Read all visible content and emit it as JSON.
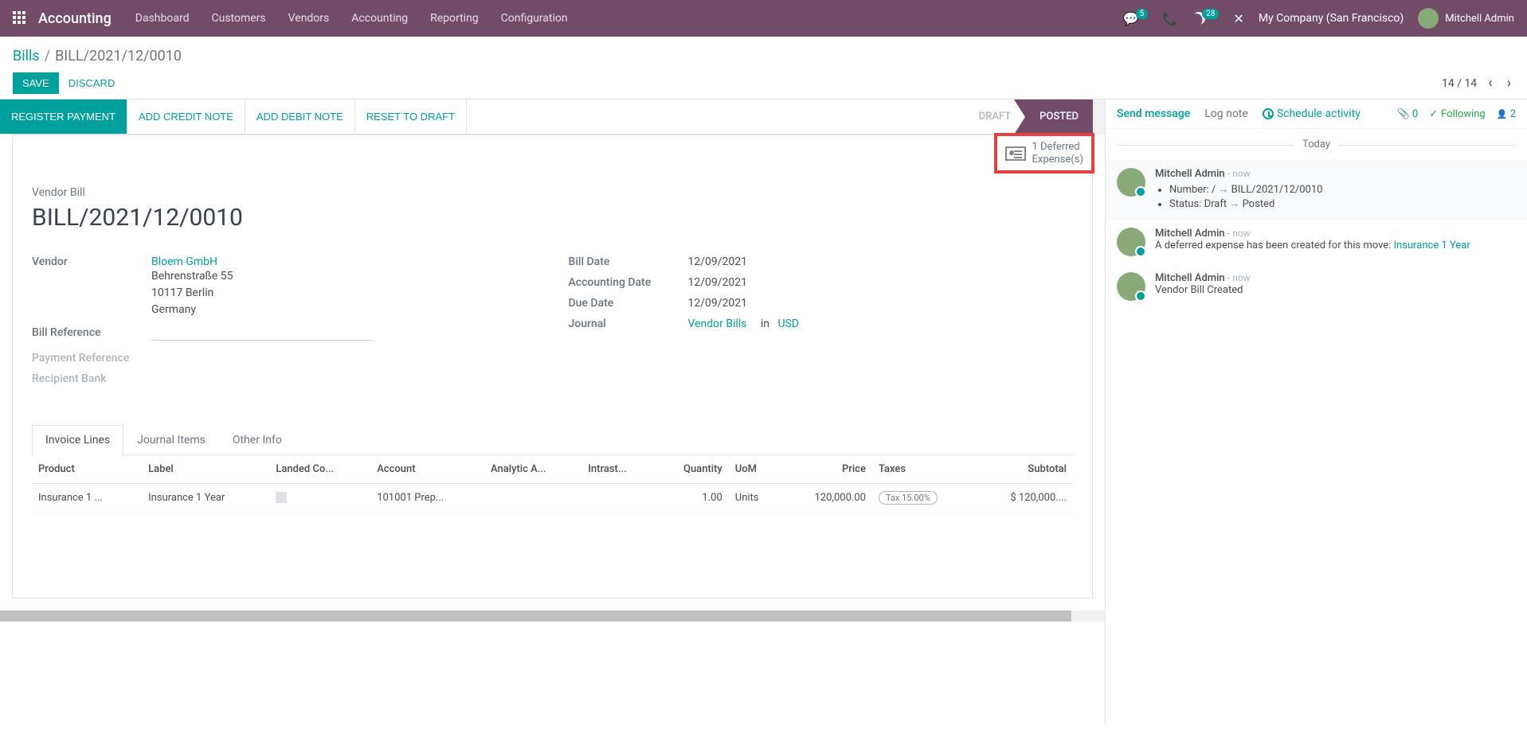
{
  "navbar": {
    "brand": "Accounting",
    "menu": [
      "Dashboard",
      "Customers",
      "Vendors",
      "Accounting",
      "Reporting",
      "Configuration"
    ],
    "messages_count": "5",
    "activities_count": "28",
    "company": "My Company (San Francisco)",
    "user": "Mitchell Admin"
  },
  "breadcrumb": {
    "root": "Bills",
    "current": "BILL/2021/12/0010"
  },
  "buttons": {
    "save": "SAVE",
    "discard": "DISCARD"
  },
  "pager": {
    "text": "14 / 14"
  },
  "statusbar": {
    "register_payment": "REGISTER PAYMENT",
    "add_credit": "ADD CREDIT NOTE",
    "add_debit": "ADD DEBIT NOTE",
    "reset": "RESET TO DRAFT",
    "draft": "DRAFT",
    "posted": "POSTED"
  },
  "stat_button": {
    "line1": "1 Deferred",
    "line2": "Expense(s)"
  },
  "sheet": {
    "label": "Vendor Bill",
    "title": "BILL/2021/12/0010",
    "left": {
      "vendor_label": "Vendor",
      "vendor_name": "Bloem GmbH",
      "addr1": "Behrenstraße 55",
      "addr2": "10117 Berlin",
      "addr3": "Germany",
      "bill_ref_label": "Bill Reference",
      "pay_ref_label": "Payment Reference",
      "bank_label": "Recipient Bank"
    },
    "right": {
      "bill_date_label": "Bill Date",
      "bill_date": "12/09/2021",
      "acct_date_label": "Accounting Date",
      "acct_date": "12/09/2021",
      "due_date_label": "Due Date",
      "due_date": "12/09/2021",
      "journal_label": "Journal",
      "journal": "Vendor Bills",
      "in": "in",
      "currency": "USD"
    }
  },
  "tabs": {
    "t1": "Invoice Lines",
    "t2": "Journal Items",
    "t3": "Other Info"
  },
  "table": {
    "headers": {
      "product": "Product",
      "label": "Label",
      "landed": "Landed Co...",
      "account": "Account",
      "analytic": "Analytic A...",
      "intrastat": "Intrast...",
      "qty": "Quantity",
      "uom": "UoM",
      "price": "Price",
      "taxes": "Taxes",
      "subtotal": "Subtotal"
    },
    "row": {
      "product": "Insurance 1 ...",
      "label": "Insurance 1 Year",
      "account": "101001 Prep...",
      "qty": "1.00",
      "uom": "Units",
      "price": "120,000.00",
      "tax": "Tax 15.00%",
      "subtotal": "$ 120,000...."
    }
  },
  "chatter": {
    "send": "Send message",
    "log": "Log note",
    "schedule": "Schedule activity",
    "attach_count": "0",
    "following": "Following",
    "followers": "2",
    "today": "Today",
    "msgs": [
      {
        "author": "Mitchell Admin",
        "time": "- now",
        "type": "track",
        "li1_label": "Number:",
        "li1_from": "/",
        "li1_to": "BILL/2021/12/0010",
        "li2_label": "Status:",
        "li2_from": "Draft",
        "li2_to": "Posted"
      },
      {
        "author": "Mitchell Admin",
        "time": "- now",
        "text": "A deferred expense has been created for this move: ",
        "link": "Insurance 1 Year"
      },
      {
        "author": "Mitchell Admin",
        "time": "- now",
        "text": "Vendor Bill Created"
      }
    ]
  }
}
